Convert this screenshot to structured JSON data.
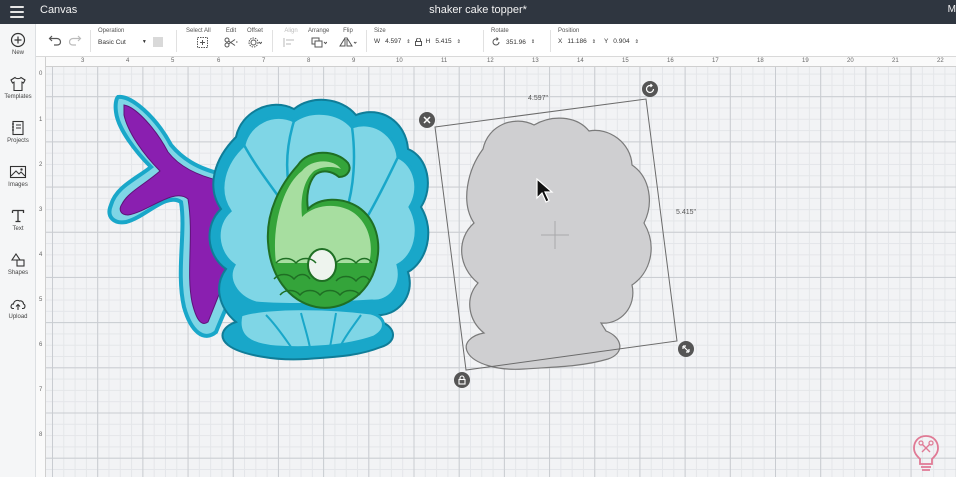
{
  "topbar": {
    "app_title": "Canvas",
    "doc_title": "shaker cake topper*",
    "user_initial": "M"
  },
  "sidebar": {
    "items": [
      {
        "label": "New",
        "icon": "plus-circle-icon"
      },
      {
        "label": "Templates",
        "icon": "shirt-icon"
      },
      {
        "label": "Projects",
        "icon": "notebook-icon"
      },
      {
        "label": "Images",
        "icon": "image-icon"
      },
      {
        "label": "Text",
        "icon": "text-t-icon"
      },
      {
        "label": "Shapes",
        "icon": "shapes-icon"
      },
      {
        "label": "Upload",
        "icon": "cloud-upload-icon"
      }
    ]
  },
  "toolbar": {
    "operation": {
      "label": "Operation",
      "value": "Basic Cut",
      "swatch": "#d9d9d9"
    },
    "select_all": {
      "label": "Select All"
    },
    "edit": {
      "label": "Edit"
    },
    "offset": {
      "label": "Offset"
    },
    "align": {
      "label": "Align"
    },
    "arrange": {
      "label": "Arrange"
    },
    "flip": {
      "label": "Flip"
    },
    "size": {
      "label": "Size",
      "w_label": "W",
      "w_value": "4.597",
      "h_label": "H",
      "h_value": "5.415"
    },
    "rotate": {
      "label": "Rotate",
      "value": "351.96"
    },
    "position": {
      "label": "Position",
      "x_label": "X",
      "x_value": "11.186",
      "y_label": "Y",
      "y_value": "0.904"
    }
  },
  "canvas": {
    "ruler_top": [
      "3",
      "4",
      "5",
      "6",
      "7",
      "8",
      "9",
      "10",
      "11",
      "12",
      "13",
      "14",
      "15",
      "16",
      "17",
      "18",
      "19",
      "20",
      "21",
      "22"
    ],
    "ruler_left": [
      "0",
      "1",
      "2",
      "3",
      "4",
      "5",
      "6",
      "7",
      "8"
    ],
    "selection": {
      "width_label": "4.597\"",
      "height_label": "5.415\""
    }
  },
  "colors": {
    "purple": "#8a1fb0",
    "teal": "#19a7c9",
    "light_teal": "#7fd6e6",
    "green": "#34a43a",
    "light_green": "#a7dea0",
    "grey_shape": "#cfcfd1"
  }
}
